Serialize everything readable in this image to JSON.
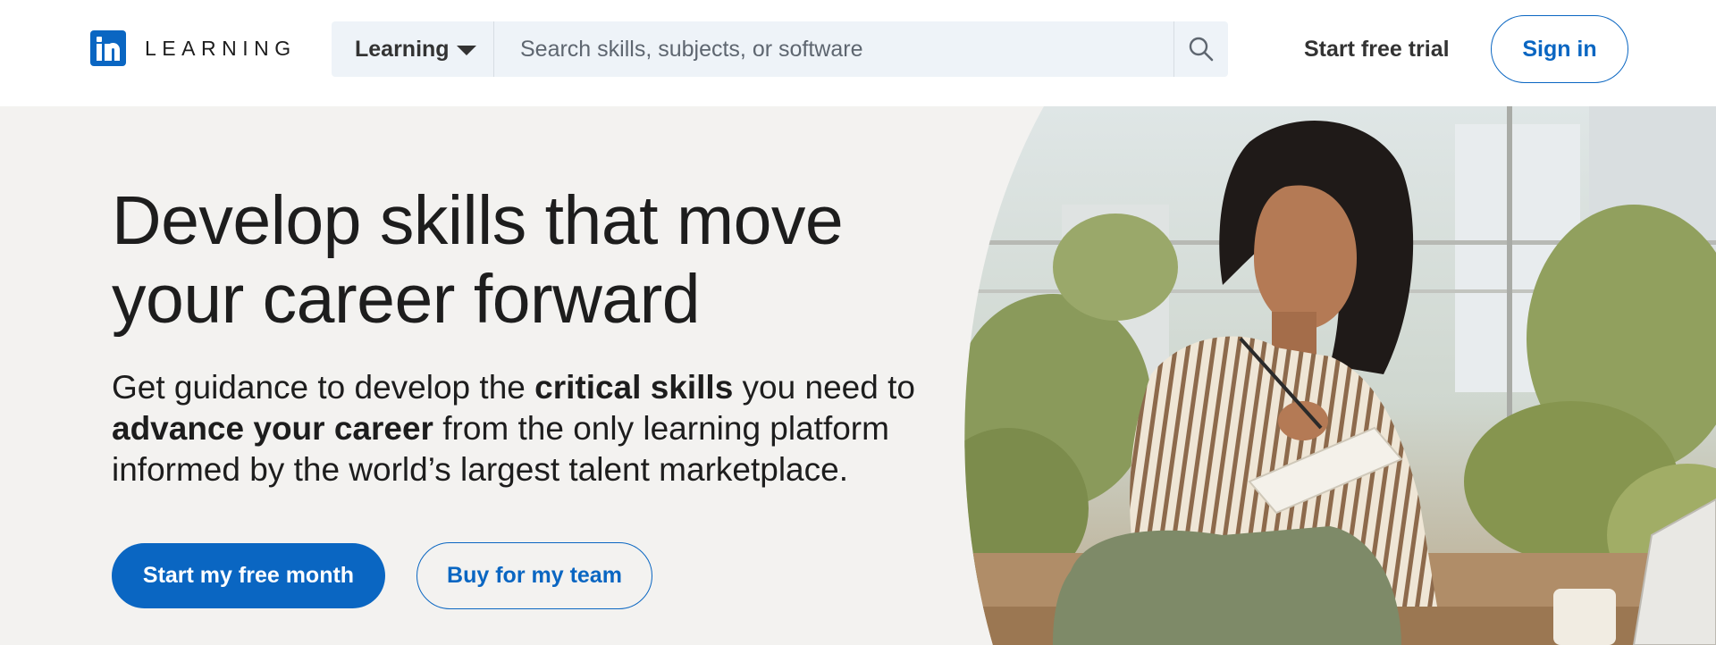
{
  "header": {
    "logo_text": "LEARNING",
    "search": {
      "category": "Learning",
      "placeholder": "Search skills, subjects, or software"
    },
    "start_trial": "Start free trial",
    "sign_in": "Sign in"
  },
  "hero": {
    "title_line1": "Develop skills that move",
    "title_line2": "your career forward",
    "subtitle": {
      "part1": "Get guidance to develop the ",
      "bold1": "critical skills",
      "part2": " you need to",
      "bold2": "advance your career",
      "part3": " from the only learning platform",
      "part4": "informed by the world’s largest talent marketplace."
    },
    "cta_primary": "Start my free month",
    "cta_secondary": "Buy for my team"
  },
  "colors": {
    "brand": "#0a66c2",
    "hero_bg": "#f3f2f0",
    "search_bg": "#eef3f8"
  },
  "icons": {
    "logo": "linkedin-in-icon",
    "caret": "caret-down-icon",
    "search": "search-icon"
  }
}
